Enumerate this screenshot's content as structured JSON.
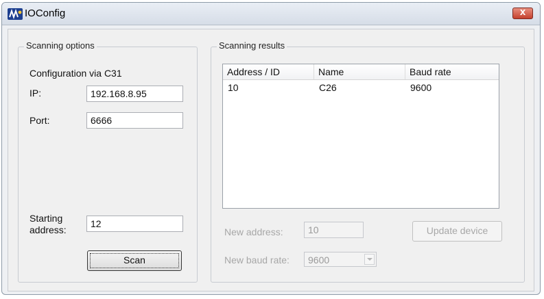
{
  "window": {
    "title": "IOConfig",
    "close_glyph": "x"
  },
  "scanning_options": {
    "legend": "Scanning options",
    "config_label": "Configuration via C31",
    "ip_label": "IP:",
    "ip_value": "192.168.8.95",
    "port_label": "Port:",
    "port_value": "6666",
    "starting_label_line1": "Starting",
    "starting_label_line2": "address:",
    "starting_value": "12",
    "scan_button": "Scan"
  },
  "scanning_results": {
    "legend": "Scanning results",
    "columns": [
      "Address / ID",
      "Name",
      "Baud rate"
    ],
    "rows": [
      {
        "address": "10",
        "name": "C26",
        "baud": "9600"
      }
    ],
    "new_address_label": "New address:",
    "new_address_value": "10",
    "new_baud_label": "New baud rate:",
    "new_baud_value": "9600",
    "update_button": "Update device"
  },
  "icons": {
    "app": "ioconfig-app-icon",
    "close": "close-icon",
    "dropdown": "chevron-down-icon"
  },
  "colors": {
    "close_button": "#c4402d",
    "window_bg": "#f0f0f0"
  }
}
